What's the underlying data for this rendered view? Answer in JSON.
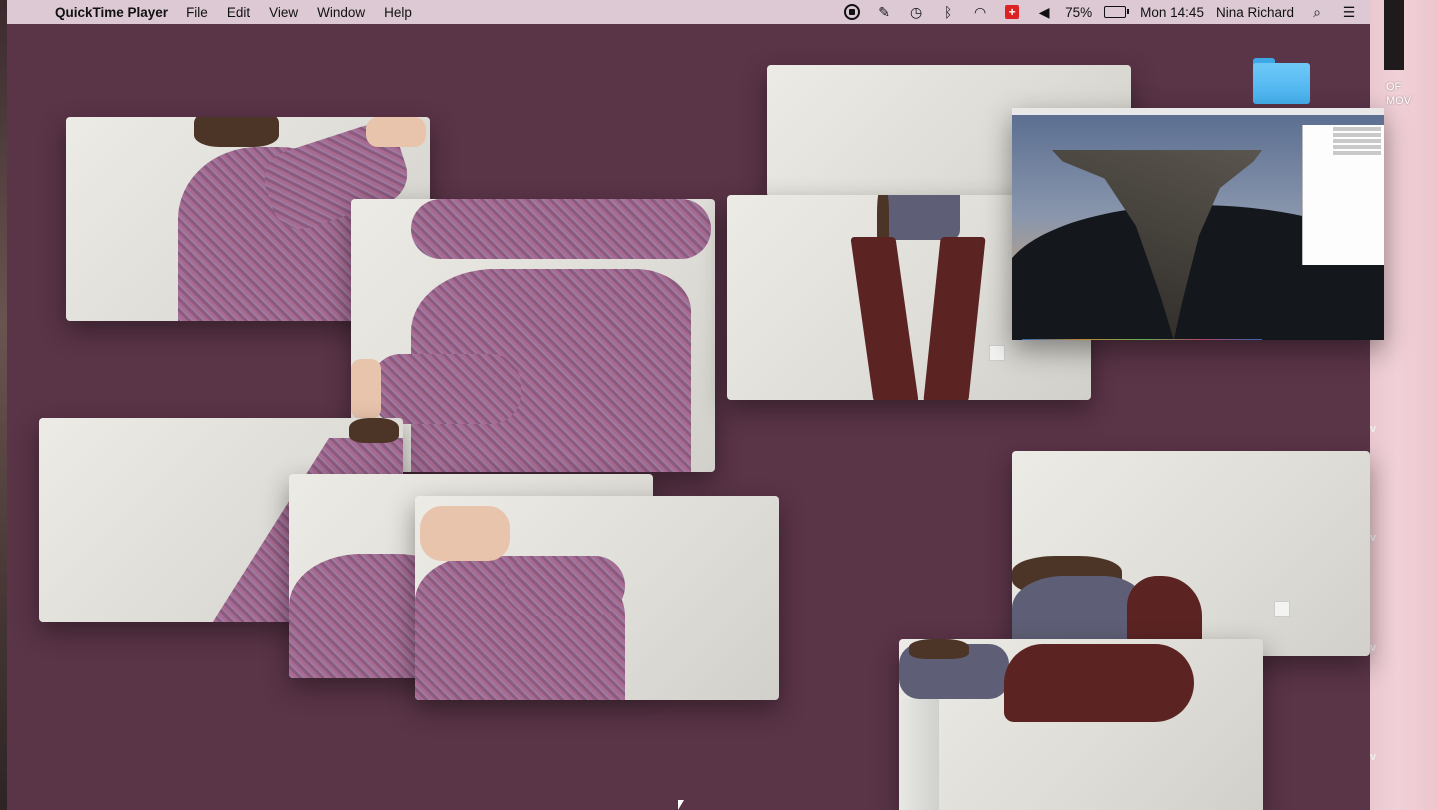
{
  "menubar": {
    "apple_glyph": "",
    "app_name": "QuickTime Player",
    "menus": [
      "File",
      "Edit",
      "View",
      "Window",
      "Help"
    ],
    "status": {
      "battery_percent": "75%",
      "clock": "Mon 14:45",
      "user": "Nina Richard"
    }
  },
  "desktop": {
    "finder_label_line1": "OF",
    "finder_label_line2": "MOV",
    "folder_color": "#4db5f0",
    "background_color": "#5a3447"
  },
  "windows": [
    {
      "name": "video-window-1",
      "content": "knit sweater arm over head"
    },
    {
      "name": "video-window-2",
      "content": "knit sweater leaning on wall"
    },
    {
      "name": "video-window-3",
      "content": "knit sweater side view"
    },
    {
      "name": "video-window-4",
      "content": "knit sweater bent over"
    },
    {
      "name": "video-window-5",
      "content": "knit sweater hands on head"
    },
    {
      "name": "video-window-6",
      "content": "person standing legs apart"
    },
    {
      "name": "video-window-7",
      "content": "screen recording desktop"
    },
    {
      "name": "video-window-8",
      "content": "person bending over"
    },
    {
      "name": "video-window-9",
      "content": "person bent over close-up"
    }
  ],
  "sidebar_chevrons": [
    "v",
    "v",
    "v",
    "v"
  ]
}
